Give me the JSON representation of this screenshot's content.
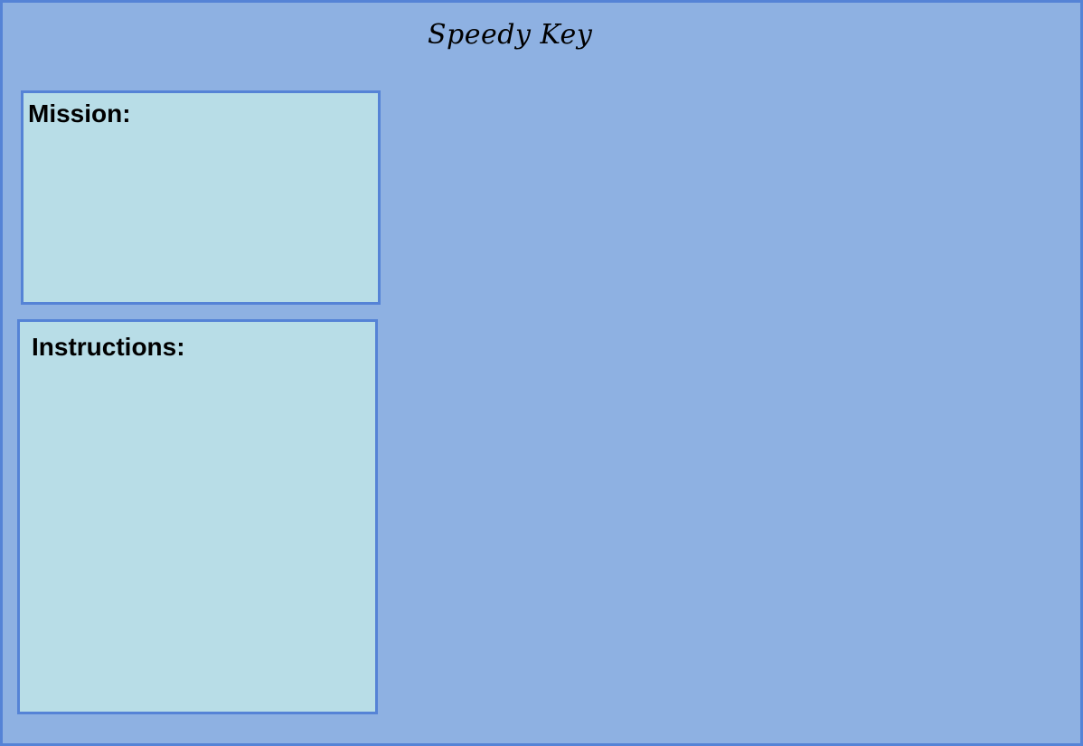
{
  "app": {
    "title": "Speedy Key"
  },
  "panels": {
    "mission": {
      "label": "Mission:"
    },
    "instructions": {
      "label": "Instructions:"
    }
  },
  "colors": {
    "background": "#8eb1e2",
    "border": "#5583d6",
    "panel_fill": "#b8dde7",
    "text": "#000000"
  }
}
